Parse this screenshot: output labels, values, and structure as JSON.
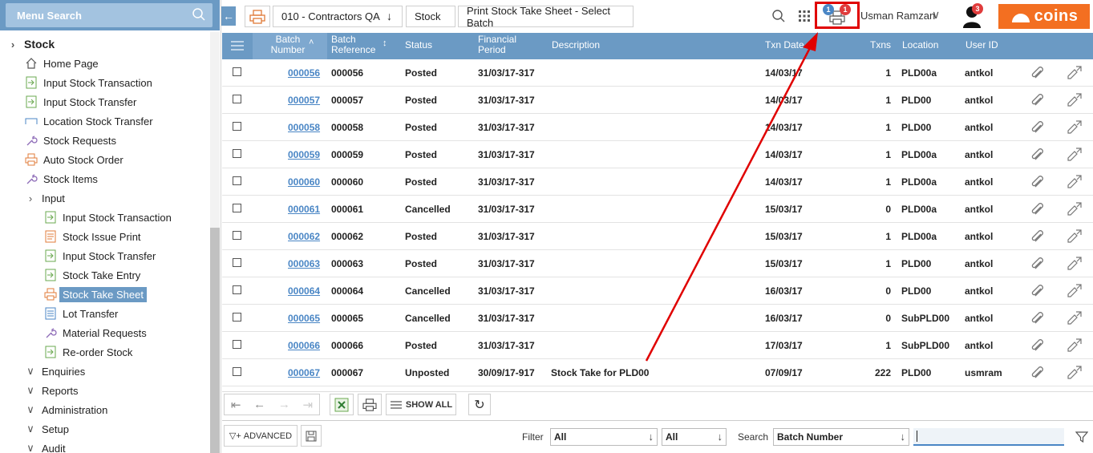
{
  "sidebar": {
    "search_label": "Menu Search",
    "items": [
      {
        "label": "Stock"
      },
      {
        "label": "Home Page"
      },
      {
        "label": "Input Stock Transaction"
      },
      {
        "label": "Input Stock Transfer"
      },
      {
        "label": "Location Stock Transfer"
      },
      {
        "label": "Stock Requests"
      },
      {
        "label": "Auto Stock Order"
      },
      {
        "label": "Stock Items"
      },
      {
        "label": "Input"
      },
      {
        "label": "Input Stock Transaction"
      },
      {
        "label": "Stock Issue Print"
      },
      {
        "label": "Input Stock Transfer"
      },
      {
        "label": "Stock Take Entry"
      },
      {
        "label": "Stock Take Sheet"
      },
      {
        "label": "Lot Transfer"
      },
      {
        "label": "Material Requests"
      },
      {
        "label": "Re-order Stock"
      },
      {
        "label": "Enquiries"
      },
      {
        "label": "Reports"
      },
      {
        "label": "Administration"
      },
      {
        "label": "Setup"
      },
      {
        "label": "Audit"
      }
    ]
  },
  "breadcrumb": {
    "company": "010 - Contractors QA",
    "module": "Stock",
    "page": "Print Stock Take Sheet - Select Batch"
  },
  "header": {
    "user_name": "Usman Ramzan",
    "print_queue_badge_blue": "1",
    "print_queue_badge_red": "1",
    "notifications_badge": "3",
    "brand": "coins"
  },
  "grid": {
    "columns": {
      "batch_number": "Batch Number",
      "batch_reference": "Batch Reference",
      "status": "Status",
      "financial_period": "Financial Period",
      "description": "Description",
      "txn_date": "Txn Date",
      "txns": "Txns",
      "location": "Location",
      "user_id": "User ID"
    },
    "rows": [
      {
        "bn": "000056",
        "ref": "000056",
        "status": "Posted",
        "period": "31/03/17-317",
        "desc": "",
        "date": "14/03/17",
        "txns": "1",
        "loc": "PLD00a",
        "user": "antkol"
      },
      {
        "bn": "000057",
        "ref": "000057",
        "status": "Posted",
        "period": "31/03/17-317",
        "desc": "",
        "date": "14/03/17",
        "txns": "1",
        "loc": "PLD00",
        "user": "antkol"
      },
      {
        "bn": "000058",
        "ref": "000058",
        "status": "Posted",
        "period": "31/03/17-317",
        "desc": "",
        "date": "14/03/17",
        "txns": "1",
        "loc": "PLD00",
        "user": "antkol"
      },
      {
        "bn": "000059",
        "ref": "000059",
        "status": "Posted",
        "period": "31/03/17-317",
        "desc": "",
        "date": "14/03/17",
        "txns": "1",
        "loc": "PLD00a",
        "user": "antkol"
      },
      {
        "bn": "000060",
        "ref": "000060",
        "status": "Posted",
        "period": "31/03/17-317",
        "desc": "",
        "date": "14/03/17",
        "txns": "1",
        "loc": "PLD00a",
        "user": "antkol"
      },
      {
        "bn": "000061",
        "ref": "000061",
        "status": "Cancelled",
        "period": "31/03/17-317",
        "desc": "",
        "date": "15/03/17",
        "txns": "0",
        "loc": "PLD00a",
        "user": "antkol"
      },
      {
        "bn": "000062",
        "ref": "000062",
        "status": "Posted",
        "period": "31/03/17-317",
        "desc": "",
        "date": "15/03/17",
        "txns": "1",
        "loc": "PLD00a",
        "user": "antkol"
      },
      {
        "bn": "000063",
        "ref": "000063",
        "status": "Posted",
        "period": "31/03/17-317",
        "desc": "",
        "date": "15/03/17",
        "txns": "1",
        "loc": "PLD00",
        "user": "antkol"
      },
      {
        "bn": "000064",
        "ref": "000064",
        "status": "Cancelled",
        "period": "31/03/17-317",
        "desc": "",
        "date": "16/03/17",
        "txns": "0",
        "loc": "PLD00",
        "user": "antkol"
      },
      {
        "bn": "000065",
        "ref": "000065",
        "status": "Cancelled",
        "period": "31/03/17-317",
        "desc": "",
        "date": "16/03/17",
        "txns": "0",
        "loc": "SubPLD00",
        "user": "antkol"
      },
      {
        "bn": "000066",
        "ref": "000066",
        "status": "Posted",
        "period": "31/03/17-317",
        "desc": "",
        "date": "17/03/17",
        "txns": "1",
        "loc": "SubPLD00",
        "user": "antkol"
      },
      {
        "bn": "000067",
        "ref": "000067",
        "status": "Unposted",
        "period": "30/09/17-917",
        "desc": "Stock Take for PLD00",
        "date": "07/09/17",
        "txns": "222",
        "loc": "PLD00",
        "user": "usmram"
      }
    ]
  },
  "pager": {
    "show_all_label": "SHOW ALL"
  },
  "filterbar": {
    "advanced_label": "ADVANCED",
    "filter_label": "Filter",
    "filter1_value": "All",
    "filter2_value": "All",
    "search_label": "Search",
    "search_field_value": "Batch Number",
    "search_input_value": ""
  },
  "colors": {
    "accent": "#6b9ac4",
    "brand": "#f36f21",
    "highlight": "#e00000",
    "link": "#4a86c5"
  }
}
